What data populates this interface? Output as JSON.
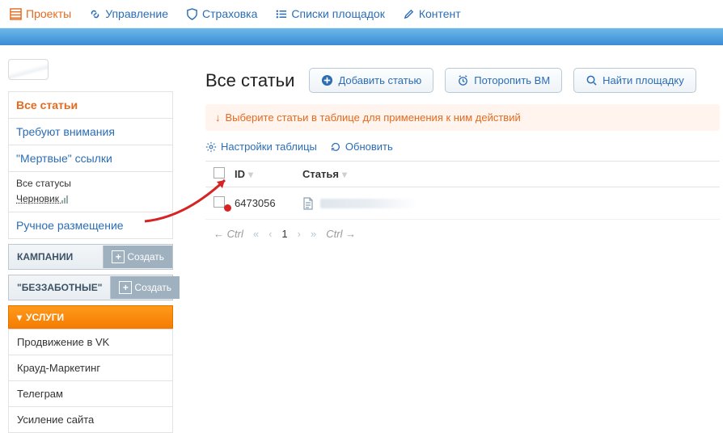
{
  "topnav": {
    "items": [
      {
        "label": "Проекты",
        "active": true
      },
      {
        "label": "Управление"
      },
      {
        "label": "Страховка"
      },
      {
        "label": "Списки площадок"
      },
      {
        "label": "Контент"
      }
    ]
  },
  "sidebar": {
    "filters": {
      "all_articles": "Все статьи",
      "need_attention": "Требуют внимания",
      "dead_links": "\"Мертвые\" ссылки",
      "all_statuses": "Все статусы",
      "draft": "Черновик",
      "manual": "Ручное размещение"
    },
    "gray1": {
      "title": "КАМПАНИИ",
      "button": "Создать"
    },
    "gray2": {
      "title": "\"БЕЗЗАБОТНЫЕ\"",
      "button": "Создать"
    },
    "services": {
      "title": "УСЛУГИ",
      "items": [
        "Продвижение в VK",
        "Крауд-Маркетинг",
        "Телеграм",
        "Усиление сайта"
      ]
    }
  },
  "main": {
    "title": "Все статьи",
    "buttons": {
      "add": "Добавить статью",
      "hurry": "Поторопить ВМ",
      "find": "Найти площадку"
    },
    "hint": "Выберите статьи в таблице для применения к ним действий",
    "tools": {
      "settings": "Настройки таблицы",
      "refresh": "Обновить"
    },
    "table": {
      "th_id": "ID",
      "th_article": "Статья",
      "rows": [
        {
          "id": "6473056"
        }
      ]
    },
    "pager": {
      "ctrl_left": "← Ctrl",
      "page": "1",
      "ctrl_right": "Ctrl →"
    }
  }
}
